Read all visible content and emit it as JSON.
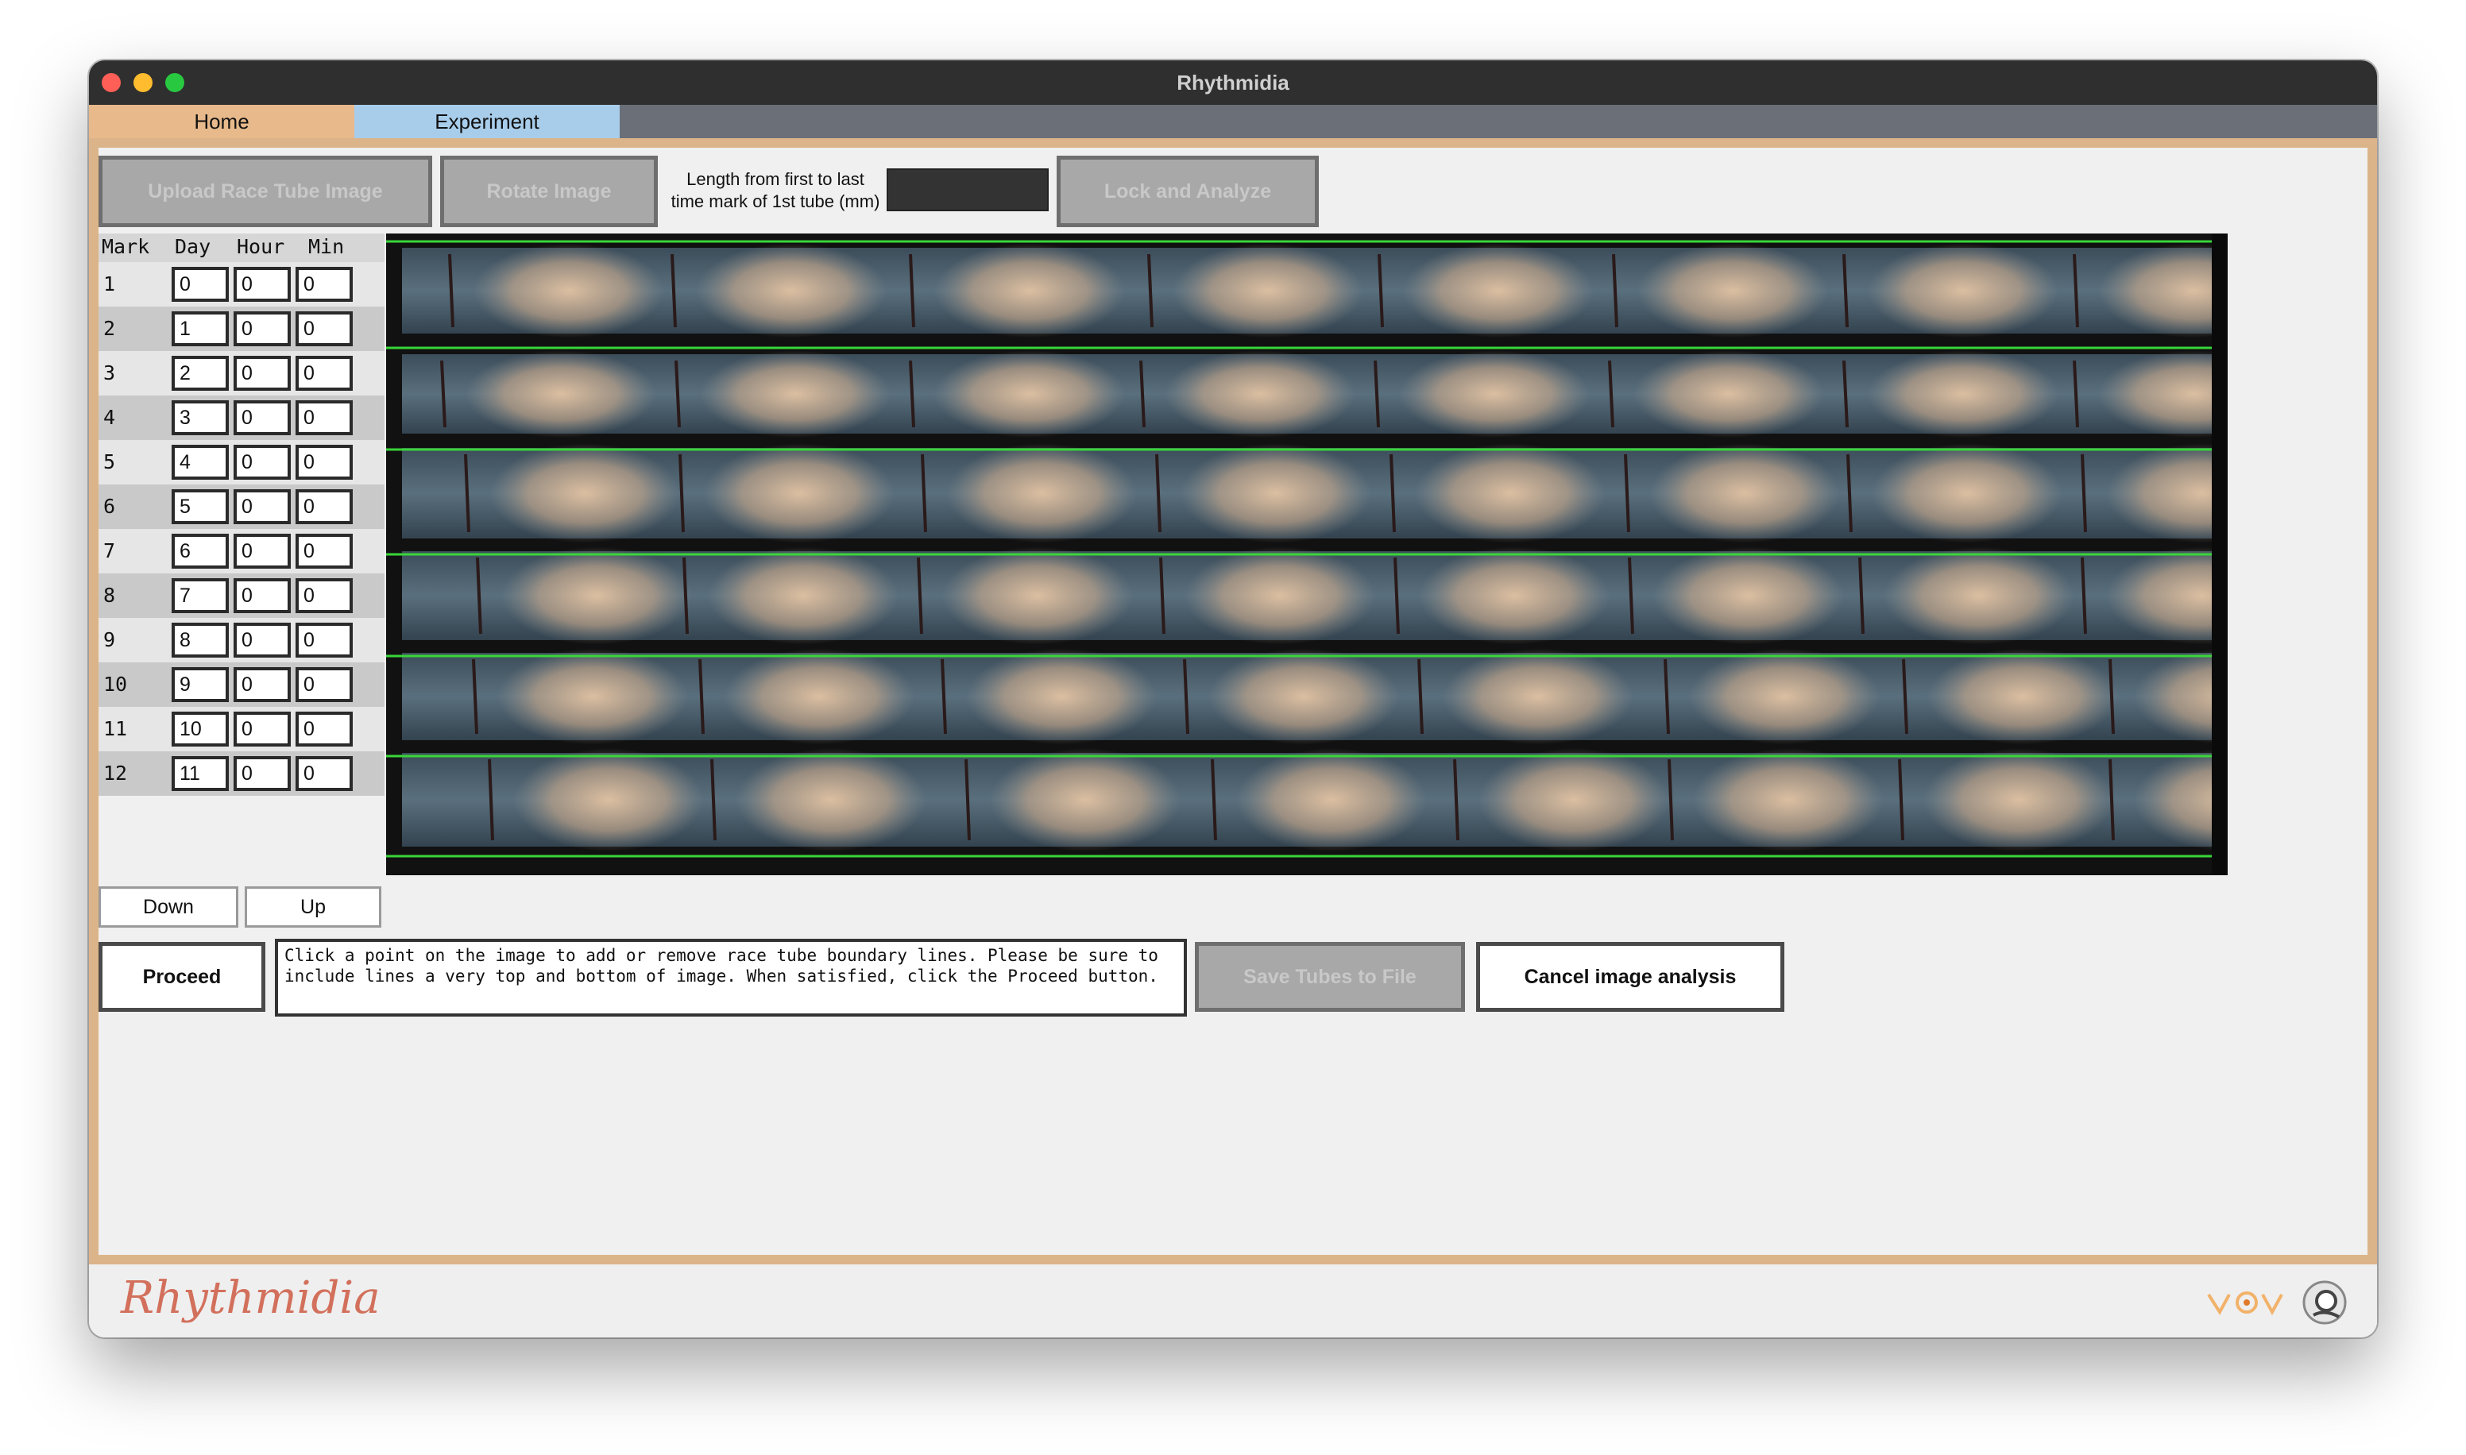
{
  "window": {
    "title": "Rhythmidia"
  },
  "tabs": [
    {
      "label": "Home",
      "color": "#e7b98b"
    },
    {
      "label": "Experiment",
      "color": "#a8cdeb"
    }
  ],
  "toolbar": {
    "upload_label": "Upload Race Tube Image",
    "rotate_label": "Rotate Image",
    "length_label_line1": "Length from first to last",
    "length_label_line2": "time mark of 1st tube (mm)",
    "length_value": "",
    "lock_label": "Lock and Analyze"
  },
  "marks_table": {
    "headers": [
      "Mark",
      "Day",
      "Hour",
      "Min"
    ],
    "rows": [
      {
        "mark": "1",
        "day": "0",
        "hour": "0",
        "min": "0"
      },
      {
        "mark": "2",
        "day": "1",
        "hour": "0",
        "min": "0"
      },
      {
        "mark": "3",
        "day": "2",
        "hour": "0",
        "min": "0"
      },
      {
        "mark": "4",
        "day": "3",
        "hour": "0",
        "min": "0"
      },
      {
        "mark": "5",
        "day": "4",
        "hour": "0",
        "min": "0"
      },
      {
        "mark": "6",
        "day": "5",
        "hour": "0",
        "min": "0"
      },
      {
        "mark": "7",
        "day": "6",
        "hour": "0",
        "min": "0"
      },
      {
        "mark": "8",
        "day": "7",
        "hour": "0",
        "min": "0"
      },
      {
        "mark": "9",
        "day": "8",
        "hour": "0",
        "min": "0"
      },
      {
        "mark": "10",
        "day": "9",
        "hour": "0",
        "min": "0"
      },
      {
        "mark": "11",
        "day": "10",
        "hour": "0",
        "min": "0"
      },
      {
        "mark": "12",
        "day": "11",
        "hour": "0",
        "min": "0"
      }
    ],
    "down_label": "Down",
    "up_label": "Up"
  },
  "actions": {
    "proceed_label": "Proceed",
    "instructions": "Click a point on the image to add or remove race tube boundary lines. Please be sure to include lines a very top and bottom of image. When satisfied, click the Proceed button.",
    "save_label": "Save Tubes to File",
    "cancel_label": "Cancel image analysis"
  },
  "footer": {
    "logo_text": "Rhythmidia"
  },
  "colors": {
    "boundary_line": "#39d639",
    "tube_bg": "#4f6473",
    "conidia": "#d8b89a",
    "time_mark": "#2a1a1a"
  }
}
